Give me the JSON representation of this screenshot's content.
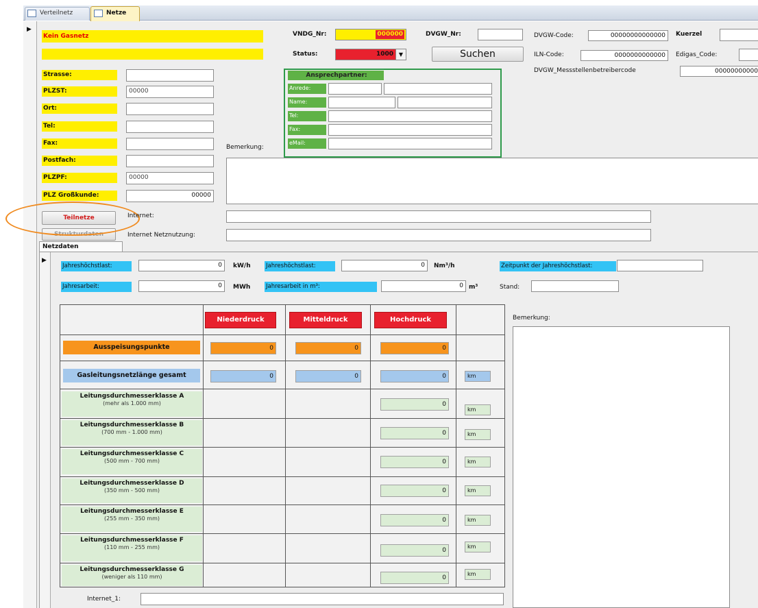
{
  "tabs": [
    {
      "label": "Verteilnetz"
    },
    {
      "label": "Netze"
    }
  ],
  "header": {
    "kein_gasnetz": "Kein Gasnetz",
    "vndg_label": "VNDG_Nr:",
    "vndg_value": "000000",
    "dvgw_nr_label": "DVGW_Nr:",
    "dvgw_nr_value": "",
    "dvgw_code_label": "DVGW-Code:",
    "dvgw_code_value": "00000000000000",
    "kuerzel_label": "Kuerzel",
    "status_label": "Status:",
    "status_value": "1000",
    "search_label": "Suchen",
    "iln_label": "ILN-Code:",
    "iln_value": "0000000000000",
    "edigas_label": "Edigas_Code:",
    "mst_label": "DVGW_Messstellenbetreibercode",
    "mst_value": "00000000000"
  },
  "address": {
    "strasse": {
      "label": "Strasse:",
      "value": ""
    },
    "plzst": {
      "label": "PLZST:",
      "value": "00000"
    },
    "ort": {
      "label": "Ort:",
      "value": ""
    },
    "tel": {
      "label": "Tel:",
      "value": ""
    },
    "fax": {
      "label": "Fax:",
      "value": ""
    },
    "postfach": {
      "label": "Postfach:",
      "value": ""
    },
    "plzpf": {
      "label": "PLZPF:",
      "value": "00000"
    },
    "plz_gross": {
      "label": "PLZ Großkunde:",
      "value": "00000"
    }
  },
  "contact": {
    "title": "Ansprechpartner:",
    "anrede": "Anrede:",
    "name": "Name:",
    "tel": "Tel:",
    "fax": "Fax:",
    "email": "eMail:"
  },
  "bemerkung_label": "Bemerkung:",
  "buttons": {
    "teilnetze": "Teilnetze",
    "strukturdaten": "Strukturdaten"
  },
  "internet_label": "Internet:",
  "internet_netz_label": "Internet Netznutzung:",
  "netzdaten_tab": "Netzdaten",
  "sub": {
    "jhl_kw_label": "Jahreshöchstlast:",
    "jhl_kw_value": "0",
    "jhl_kw_unit": "kW/h",
    "jhl_nm_label": "Jahreshöchstlast:",
    "jhl_nm_value": "0",
    "jhl_nm_unit": "Nm³/h",
    "zeitpunkt_label": "Zeitpunkt der Jahreshöchstlast:",
    "ja_label": "Jahresarbeit:",
    "ja_value": "0",
    "ja_unit": "MWh",
    "ja_m3_label": "Jahresarbeit in m³:",
    "ja_m3_value": "0",
    "ja_m3_unit": "m³",
    "stand_label": "Stand:",
    "bemerkung_label": "Bemerkung:",
    "internet1_label": "Internet_1:"
  },
  "grid": {
    "headers": [
      "Niederdruck",
      "Mitteldruck",
      "Hochdruck"
    ],
    "ausspeisung": {
      "label": "Ausspeisungspunkte",
      "values": [
        "0",
        "0",
        "0"
      ]
    },
    "gesamt": {
      "label": "Gasleitungsnetzlänge gesamt",
      "values": [
        "0",
        "0",
        "0"
      ],
      "unit": "km"
    },
    "rows": [
      {
        "title": "Leitungsdurchmesserklasse A",
        "sub": "(mehr als 1.000 mm)",
        "value": "0",
        "unit": "km"
      },
      {
        "title": "Leitungsdurchmesserklasse B",
        "sub": "(700 mm - 1.000 mm)",
        "value": "0",
        "unit": "km"
      },
      {
        "title": "Leitungsdurchmesserklasse C",
        "sub": "(500 mm - 700 mm)",
        "value": "0",
        "unit": "km"
      },
      {
        "title": "Leitungsdurchmesserklasse D",
        "sub": "(350 mm - 500 mm)",
        "value": "0",
        "unit": "km"
      },
      {
        "title": "Leitungsdurchmesserklasse E",
        "sub": "(255 mm - 350 mm)",
        "value": "0",
        "unit": "km"
      },
      {
        "title": "Leitungsdurchmesserklasse F",
        "sub": "(110 mm - 255 mm)",
        "value": "0",
        "unit": "km"
      },
      {
        "title": "Leitungsdurchmesserklasse G",
        "sub": "(weniger als 110 mm)",
        "value": "0",
        "unit": "km"
      }
    ]
  },
  "colors": {
    "yellow": "#ffef00",
    "red": "#e8212e",
    "orange": "#f7941d",
    "blue": "#33c3f5",
    "green": "#5fb246",
    "highlight_circle": "#f08a1e"
  }
}
